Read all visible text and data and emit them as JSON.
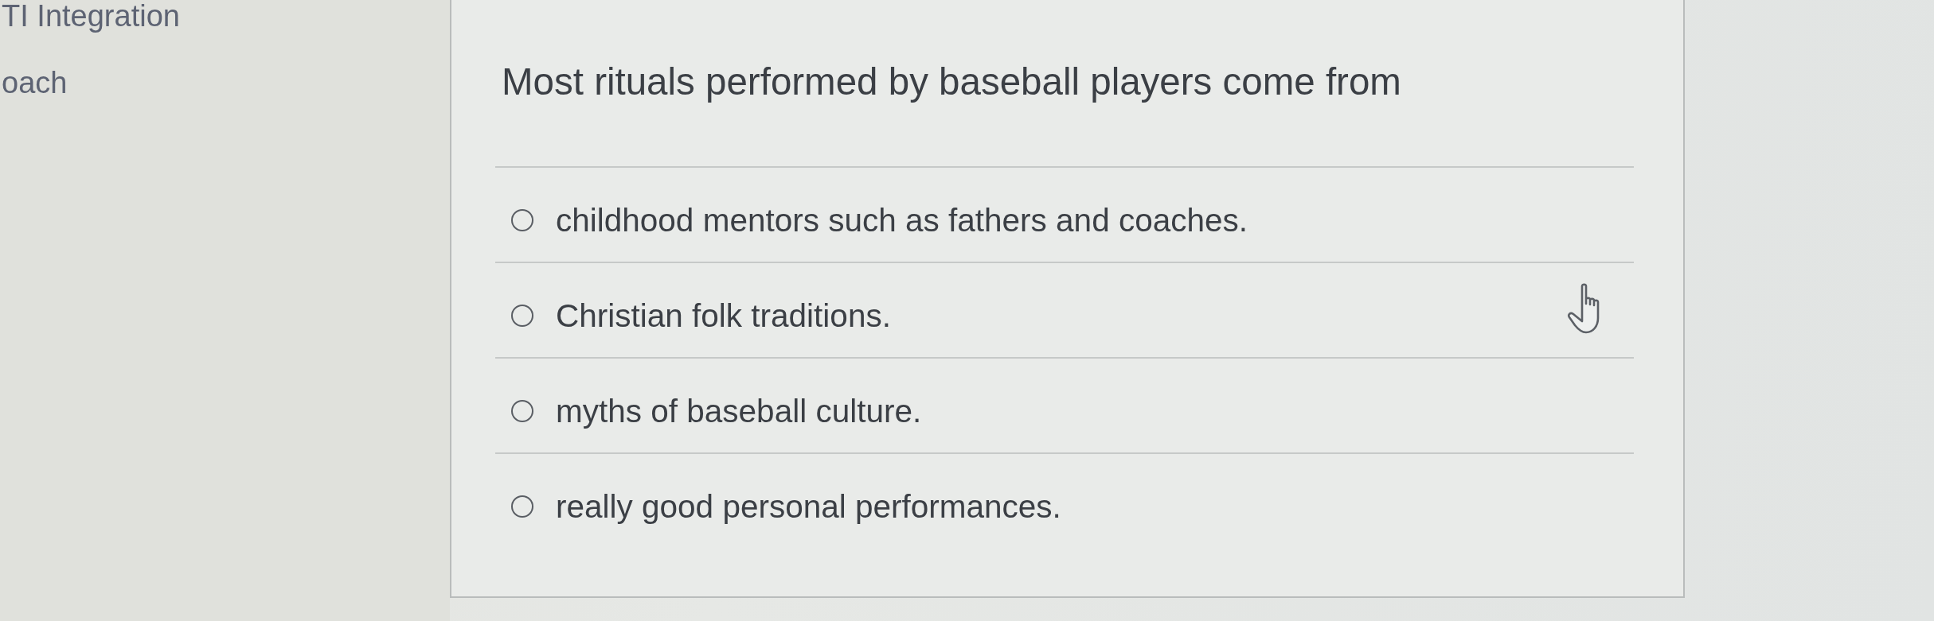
{
  "sidebar": {
    "items": [
      {
        "label": "TI Integration"
      },
      {
        "label": "oach"
      }
    ]
  },
  "question": {
    "prompt": "Most rituals performed by baseball players come from",
    "options": [
      {
        "label": "childhood mentors such as fathers and coaches.",
        "selected": false
      },
      {
        "label": "Christian folk traditions.",
        "selected": false
      },
      {
        "label": "myths of baseball culture.",
        "selected": false
      },
      {
        "label": "really good personal performances.",
        "selected": false
      }
    ]
  }
}
